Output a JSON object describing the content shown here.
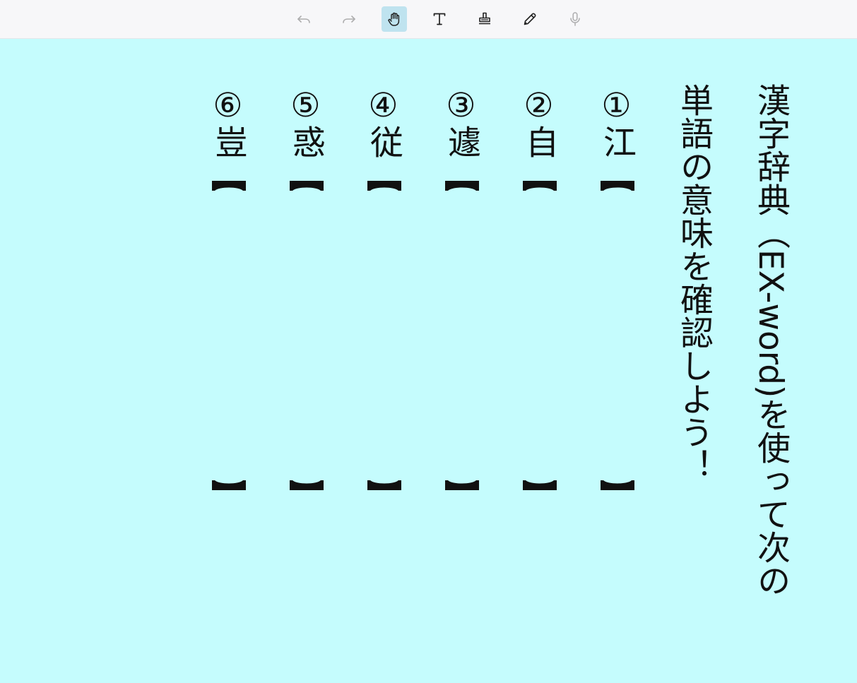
{
  "toolbar": {
    "tools": [
      {
        "name": "undo",
        "icon": "undo-icon",
        "state": "disabled"
      },
      {
        "name": "redo",
        "icon": "redo-icon",
        "state": "disabled"
      },
      {
        "name": "hand",
        "icon": "hand-icon",
        "state": "active"
      },
      {
        "name": "text",
        "icon": "text-icon",
        "state": "enabled"
      },
      {
        "name": "stamp",
        "icon": "stamp-icon",
        "state": "enabled"
      },
      {
        "name": "pen",
        "icon": "pencil-icon",
        "state": "enabled"
      },
      {
        "name": "mic",
        "icon": "microphone-icon",
        "state": "disabled"
      }
    ]
  },
  "colors": {
    "canvas_background": "#c5fcfd",
    "toolbar_background": "#f7f7f9",
    "active_tool_background": "#bfe3ef",
    "text": "#111111"
  },
  "instructions": {
    "line1": "漢字辞典（EX-word)を使って次の",
    "line2": "単語の意味を確認しよう！"
  },
  "items": [
    {
      "number": "①",
      "word": "江"
    },
    {
      "number": "②",
      "word": "自"
    },
    {
      "number": "③",
      "word": "遽"
    },
    {
      "number": "④",
      "word": "従"
    },
    {
      "number": "⑤",
      "word": "惑"
    },
    {
      "number": "⑥",
      "word": "豈"
    }
  ]
}
